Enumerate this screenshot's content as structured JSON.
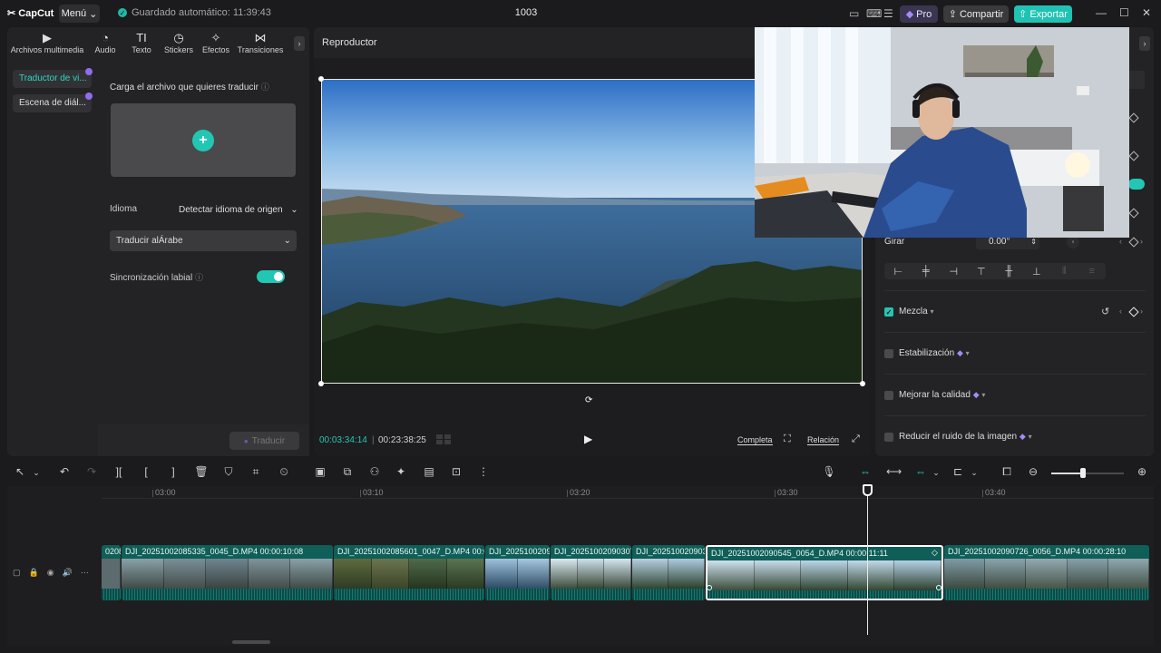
{
  "titlebar": {
    "app_name": "CapCut",
    "menu_label": "Menú",
    "autosave": "Guardado automático: 11:39:43",
    "project_title": "1003",
    "pro_label": "Pro",
    "share_label": "Compartir",
    "export_label": "Exportar"
  },
  "left_panel": {
    "tabs": [
      {
        "label": "Archivos multimedia",
        "icon": "media-icon"
      },
      {
        "label": "Audio",
        "icon": "audio-icon"
      },
      {
        "label": "Texto",
        "icon": "text-icon"
      },
      {
        "label": "Stickers",
        "icon": "sticker-icon"
      },
      {
        "label": "Efectos",
        "icon": "effects-icon"
      },
      {
        "label": "Transiciones",
        "icon": "transitions-icon"
      }
    ],
    "side_items": [
      {
        "label": "Traductor de vi..."
      },
      {
        "label": "Escena de diál..."
      }
    ],
    "upload_label": "Carga el archivo que quieres traducir",
    "language_label": "Idioma",
    "language_value": "Detectar idioma de origen",
    "translate_to": "Traducir alÁrabe",
    "lipsync_label": "Sincronización labial",
    "lipsync_on": true,
    "translate_button": "Traducir"
  },
  "player": {
    "title": "Reproductor",
    "current_time": "00:03:34:14",
    "total_time": "00:23:38:25",
    "full_label": "Completa",
    "ratio_label": "Relación"
  },
  "right_panel": {
    "rotate_label": "Girar",
    "rotate_value": "0.00°",
    "blend_label": "Mezcla",
    "blend_checked": true,
    "stabilization_label": "Estabilización",
    "enhance_label": "Mejorar la calidad",
    "denoise_label": "Reducir el ruido de la imagen"
  },
  "timeline": {
    "ruler": [
      "03:00",
      "03:10",
      "03:20",
      "03:30",
      "03:40"
    ],
    "clips": [
      {
        "title": "0208"
      },
      {
        "title": "DJI_20251002085335_0045_D.MP4   00:00:10:08"
      },
      {
        "title": "DJI_20251002085601_0047_D.MP4   00:0"
      },
      {
        "title": "DJI_2025100209"
      },
      {
        "title": "DJI_20251002090307"
      },
      {
        "title": "DJI_202510020903"
      },
      {
        "title": "DJI_20251002090545_0054_D.MP4   00:00:11:11"
      },
      {
        "title": "DJI_20251002090726_0056_D.MP4   00:00:28:10"
      }
    ]
  },
  "colors": {
    "accent": "#22c7b4",
    "pro": "#8f6cf0",
    "clip": "#0f5e58"
  }
}
